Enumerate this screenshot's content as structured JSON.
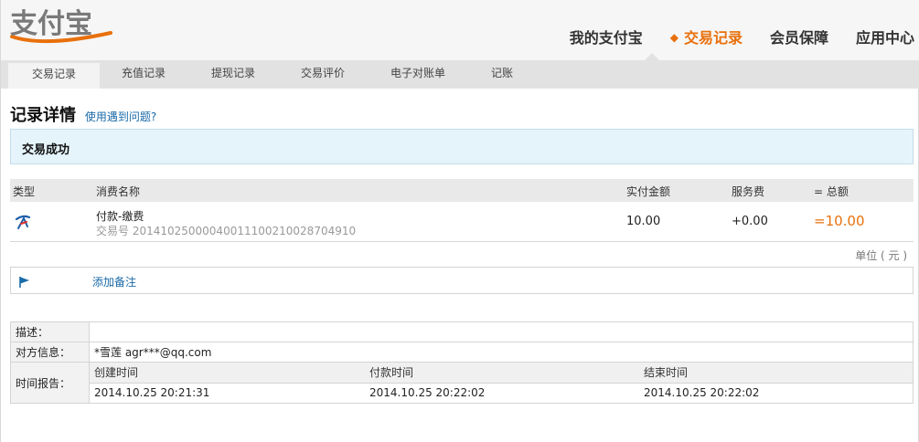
{
  "brand": {
    "logo_text": "支付宝"
  },
  "top_nav": [
    {
      "label": "我的支付宝",
      "active": false
    },
    {
      "label": "交易记录",
      "active": true
    },
    {
      "label": "会员保障",
      "active": false
    },
    {
      "label": "应用中心",
      "active": false
    }
  ],
  "sub_nav": [
    {
      "label": "交易记录",
      "active": true
    },
    {
      "label": "充值记录",
      "active": false
    },
    {
      "label": "提现记录",
      "active": false
    },
    {
      "label": "交易评价",
      "active": false
    },
    {
      "label": "电子对账单",
      "active": false
    },
    {
      "label": "记账",
      "active": false
    }
  ],
  "page": {
    "title": "记录详情",
    "help_link": "使用遇到问题?"
  },
  "status": {
    "text": "交易成功"
  },
  "tx_table": {
    "headers": {
      "type": "类型",
      "name": "消费名称",
      "paid": "实付金额",
      "fee": "服务费",
      "total": "= 总额"
    },
    "row": {
      "name": "付款-缴费",
      "tx_no": "交易号 2014102500004001110021002870491​0",
      "paid": "10.00",
      "fee": "+0.00",
      "total": "=10.00"
    },
    "unit": "单位 ( 元 )"
  },
  "note": {
    "add_label": "添加备注"
  },
  "detail": {
    "desc_label": "描述：",
    "desc_value": "",
    "party_label": "对方信息：",
    "party_value": "*雪莲 agr***@qq.com",
    "time_label": "时间报告：",
    "time_headers": [
      "创建时间",
      "付款时间",
      "结束时间"
    ],
    "time_values": [
      "2014.10.25 20:21:31",
      "2014.10.25 20:22:02",
      "2014.10.25 20:22:02"
    ]
  },
  "colors": {
    "accent": "#e8700c",
    "link": "#1a6aa8",
    "status_bg": "#e5f4fb"
  }
}
